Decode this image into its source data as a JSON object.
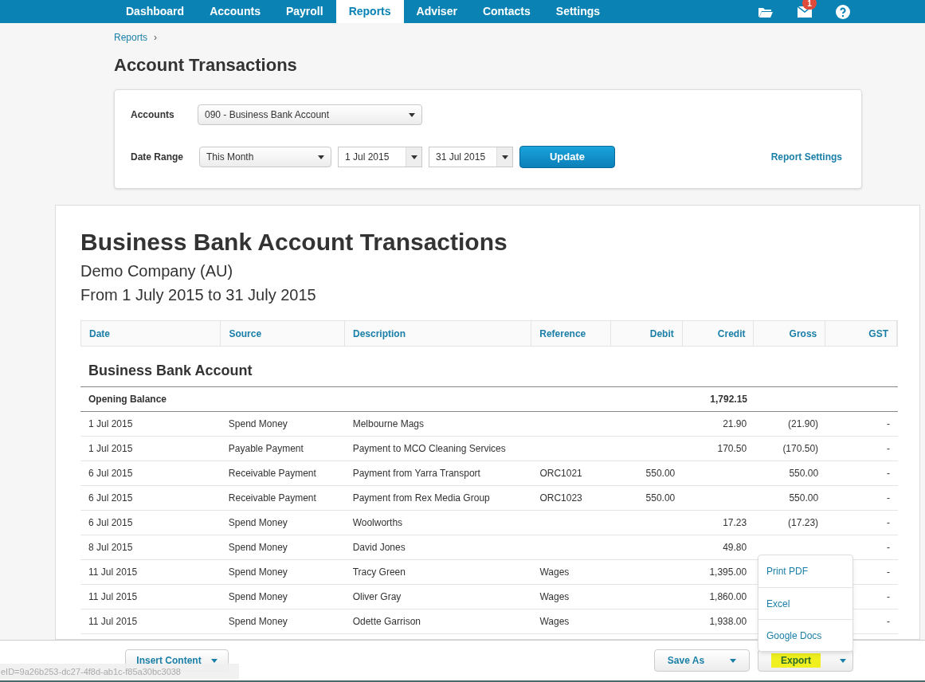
{
  "nav": {
    "items": [
      {
        "label": "Dashboard",
        "selected": false
      },
      {
        "label": "Accounts",
        "selected": false
      },
      {
        "label": "Payroll",
        "selected": false
      },
      {
        "label": "Reports",
        "selected": true
      },
      {
        "label": "Adviser",
        "selected": false
      },
      {
        "label": "Contacts",
        "selected": false
      },
      {
        "label": "Settings",
        "selected": false
      }
    ],
    "mail_badge": "1"
  },
  "breadcrumb": [
    "Reports",
    "›"
  ],
  "page_title": "Account Transactions",
  "filters": {
    "accounts_label": "Accounts",
    "account": "090 - Business Bank Account",
    "date_range_label": "Date Range",
    "range": "This Month",
    "from": "1 Jul 2015",
    "to": "31 Jul 2015",
    "update": "Update",
    "report_settings": "Report Settings"
  },
  "report": {
    "title": "Business Bank Account Transactions",
    "company": "Demo Company (AU)",
    "period": "From 1 July 2015 to 31 July 2015",
    "columns": [
      "Date",
      "Source",
      "Description",
      "Reference",
      "Debit",
      "Credit",
      "Gross",
      "GST"
    ],
    "section": "Business Bank Account",
    "opening": {
      "label": "Opening Balance",
      "credit": "1,792.15"
    },
    "rows": [
      {
        "date": "1 Jul 2015",
        "source": "Spend Money",
        "description": "Melbourne Mags",
        "credit": "21.90",
        "gross": "(21.90)",
        "gst": "-"
      },
      {
        "date": "1 Jul 2015",
        "source": "Payable Payment",
        "description": "Payment to MCO Cleaning Services",
        "credit": "170.50",
        "gross": "(170.50)",
        "gst": "-"
      },
      {
        "date": "6 Jul 2015",
        "source": "Receivable Payment",
        "description": "Payment from Yarra Transport",
        "reference": "ORC1021",
        "debit": "550.00",
        "gross": "550.00",
        "gst": "-"
      },
      {
        "date": "6 Jul 2015",
        "source": "Receivable Payment",
        "description": "Payment from Rex Media Group",
        "reference": "ORC1023",
        "debit": "550.00",
        "gross": "550.00",
        "gst": "-"
      },
      {
        "date": "6 Jul 2015",
        "source": "Spend Money",
        "description": "Woolworths",
        "credit": "17.23",
        "gross": "(17.23)",
        "gst": "-"
      },
      {
        "date": "8 Jul 2015",
        "source": "Spend Money",
        "description": "David Jones",
        "credit": "49.80",
        "gst": "-"
      },
      {
        "date": "11 Jul 2015",
        "source": "Spend Money",
        "description": "Tracy Green",
        "reference": "Wages",
        "credit": "1,395.00",
        "gst": "-"
      },
      {
        "date": "11 Jul 2015",
        "source": "Spend Money",
        "description": "Oliver Gray",
        "reference": "Wages",
        "credit": "1,860.00",
        "gst": "-"
      },
      {
        "date": "11 Jul 2015",
        "source": "Spend Money",
        "description": "Odette Garrison",
        "reference": "Wages",
        "credit": "1,938.00",
        "gst": "-"
      }
    ]
  },
  "footer": {
    "insert": "Insert Content",
    "save_as": "Save As",
    "export": {
      "label": "Export",
      "highlighted": true,
      "expanded": true,
      "menu": [
        "Print PDF",
        "Excel",
        "Google Docs"
      ]
    }
  },
  "status_text": "eID=9a26b253-dc27-4f8d-ab1c-f85a30bc3038"
}
